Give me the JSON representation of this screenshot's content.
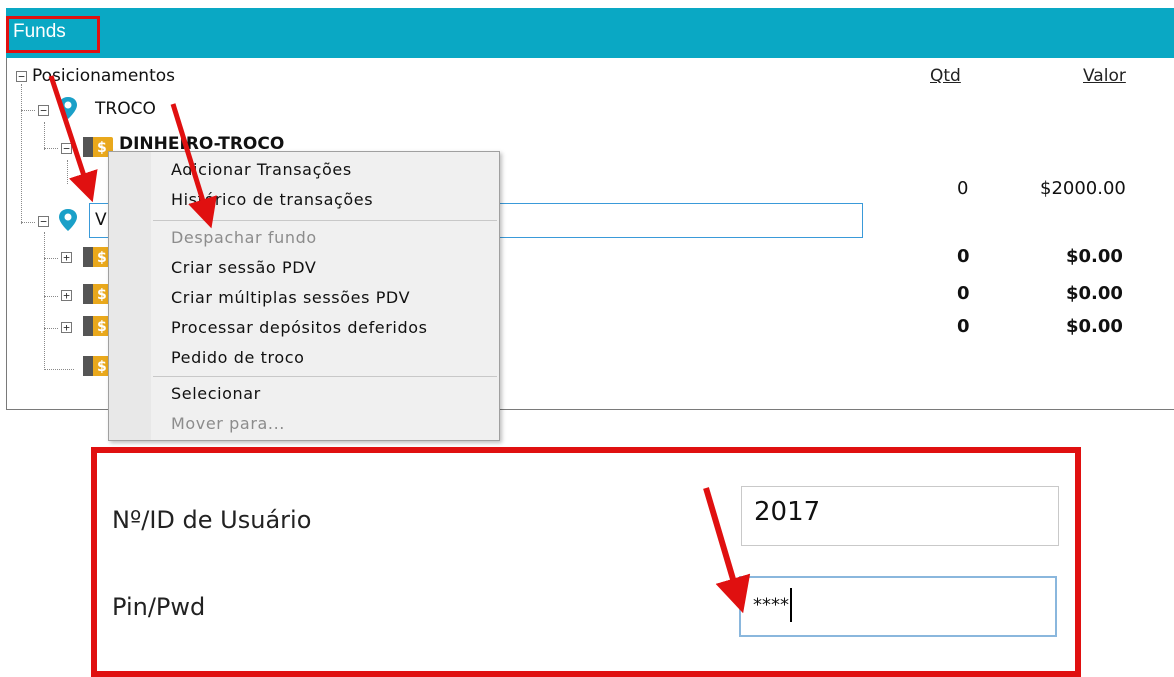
{
  "panel": {
    "title": "Funds"
  },
  "tree": {
    "header": {
      "root_label": "Posicionamentos",
      "col_qty": "Qtd",
      "col_value": "Valor"
    },
    "nodes": {
      "troco": "TROCO",
      "dinheiro_troco": "DINHEIRO-TROCO",
      "edit_value": "V"
    },
    "rows": [
      {
        "qty": "0",
        "value": "$2000.00",
        "bold": false
      },
      {
        "qty": "0",
        "value": "$0.00",
        "bold": true
      },
      {
        "qty": "0",
        "value": "$0.00",
        "bold": true
      },
      {
        "qty": "0",
        "value": "$0.00",
        "bold": true
      }
    ]
  },
  "context_menu": {
    "items": [
      {
        "label": "Adicionar Transações",
        "enabled": true
      },
      {
        "label": "Histórico de transações",
        "enabled": true
      },
      {
        "label": "Despachar fundo",
        "enabled": false
      },
      {
        "label": "Criar sessão PDV",
        "enabled": true
      },
      {
        "label": "Criar múltiplas sessões PDV",
        "enabled": true
      },
      {
        "label": "Processar depósitos deferidos",
        "enabled": true
      },
      {
        "label": "Pedido de troco",
        "enabled": true
      },
      {
        "label": "Selecionar",
        "enabled": true
      },
      {
        "label": "Mover para...",
        "enabled": false
      }
    ]
  },
  "login": {
    "user_label": "Nº/ID de Usuário",
    "user_value": "2017",
    "pin_label": "Pin/Pwd",
    "pin_value": "****"
  },
  "colors": {
    "titlebar": "#0aa8c4",
    "annotation": "#e01010",
    "pin_icon": "#1aa0c8",
    "coin": "#e9a81c"
  },
  "icons": [
    "location-pin-icon",
    "dollar-coin-icon",
    "collapse-icon",
    "expand-icon",
    "annotation-arrow"
  ]
}
